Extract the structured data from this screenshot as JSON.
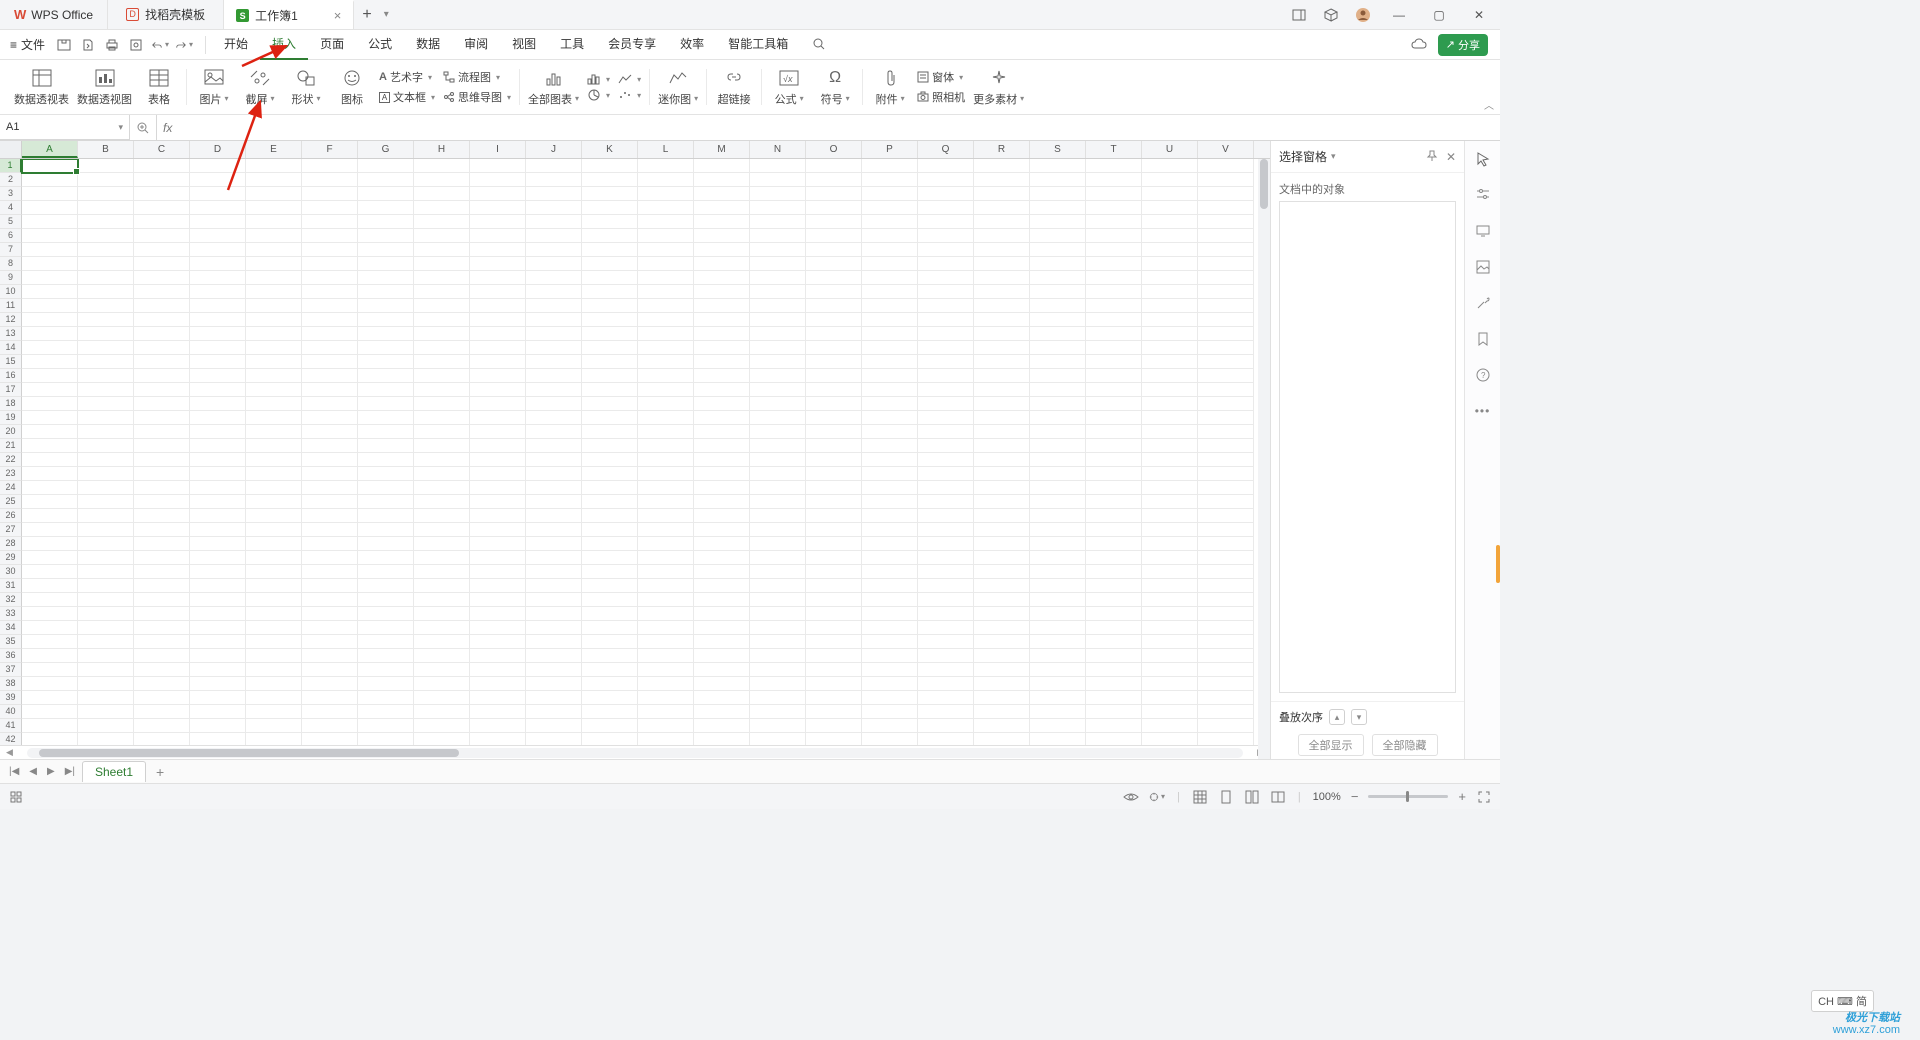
{
  "title_tabs": {
    "home": "WPS Office",
    "template": "找稻壳模板",
    "doc": "工作簿1"
  },
  "file_menu": "文件",
  "menu_tabs": [
    "开始",
    "插入",
    "页面",
    "公式",
    "数据",
    "审阅",
    "视图",
    "工具",
    "会员专享",
    "效率",
    "智能工具箱"
  ],
  "active_menu_index": 1,
  "ribbon": {
    "pivot_table": "数据透视表",
    "pivot_chart": "数据透视图",
    "table": "表格",
    "picture": "图片",
    "screenshot": "截屏",
    "shapes": "形状",
    "icons": "图标",
    "wordart": "艺术字",
    "textbox": "文本框",
    "flowchart": "流程图",
    "mindmap": "思维导图",
    "all_charts": "全部图表",
    "sparkline": "迷你图",
    "hyperlink": "超链接",
    "equation": "公式",
    "symbol": "符号",
    "attachment": "附件",
    "forms": "窗体",
    "camera": "照相机",
    "more_assets": "更多素材"
  },
  "name_box": "A1",
  "columns": [
    "A",
    "B",
    "C",
    "D",
    "E",
    "F",
    "G",
    "H",
    "I",
    "J",
    "K",
    "L",
    "M",
    "N",
    "O",
    "P",
    "Q",
    "R",
    "S",
    "T",
    "U",
    "V"
  ],
  "row_count": 43,
  "active_cell": {
    "col": 0,
    "row": 0
  },
  "side_pane": {
    "title": "选择窗格",
    "sub": "文档中的对象",
    "stack_label": "叠放次序",
    "show_all": "全部显示",
    "hide_all": "全部隐藏"
  },
  "sheet_tabs": [
    "Sheet1"
  ],
  "status": {
    "zoom": "100%"
  },
  "share_label": "分享",
  "ime_label": "CH ⌨ 简",
  "watermark": {
    "line1": "极光下载站",
    "line2": "www.xz7.com"
  }
}
